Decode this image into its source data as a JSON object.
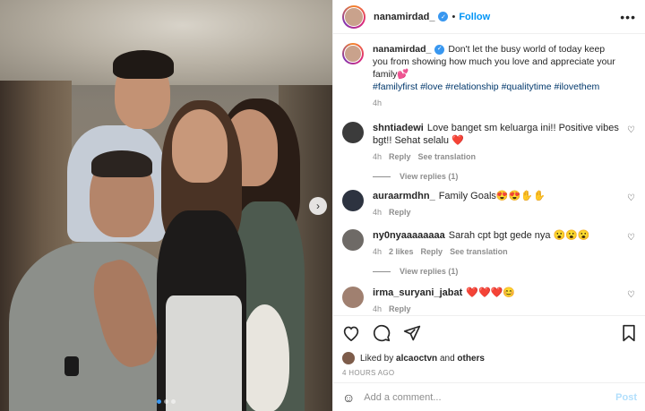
{
  "post": {
    "username": "nanamirdad_",
    "follow_label": "Follow",
    "separator": "•",
    "more_label": "•••"
  },
  "caption": {
    "username": "nanamirdad_",
    "text": "Don't let the busy world of today keep you from showing how much you love and appreciate your family💕",
    "hashtags": "#familyfirst #love #relationship #qualitytime #ilovethem",
    "time": "4h"
  },
  "comments": [
    {
      "username": "shntiadewi",
      "text": "Love banget sm keluarga ini!! Positive vibes bgt!! Sehat selalu ❤️",
      "time": "4h",
      "reply": "Reply",
      "translate": "See translation",
      "view_replies": "View replies (1)",
      "avatar_color": "#3b3b3b"
    },
    {
      "username": "auraarmdhn_",
      "text": "Family Goals😍😍✋✋",
      "time": "4h",
      "reply": "Reply",
      "avatar_color": "#2d3340"
    },
    {
      "username": "ny0nyaaaaaaaa",
      "text": "Sarah cpt bgt gede nya 😮😮😮",
      "time": "4h",
      "likes": "2 likes",
      "reply": "Reply",
      "translate": "See translation",
      "view_replies": "View replies (1)",
      "avatar_color": "#6e6a66"
    },
    {
      "username": "irma_suryani_jabat",
      "text": "❤️❤️❤️😊",
      "time": "4h",
      "reply": "Reply",
      "avatar_color": "#a08070"
    }
  ],
  "likes": {
    "prefix": "Liked by",
    "user": "alcaoctvn",
    "and": "and",
    "others": "others"
  },
  "timestamp": "4 HOURS AGO",
  "add_comment": {
    "placeholder": "Add a comment...",
    "emoji": "☺",
    "post_label": "Post"
  },
  "carousel": {
    "next": "›",
    "slides": 3,
    "active": 1
  },
  "colors": {
    "accent": "#0095f6",
    "verified": "#3897f0",
    "hashtag": "#00376b",
    "muted": "#8e8e8e"
  }
}
